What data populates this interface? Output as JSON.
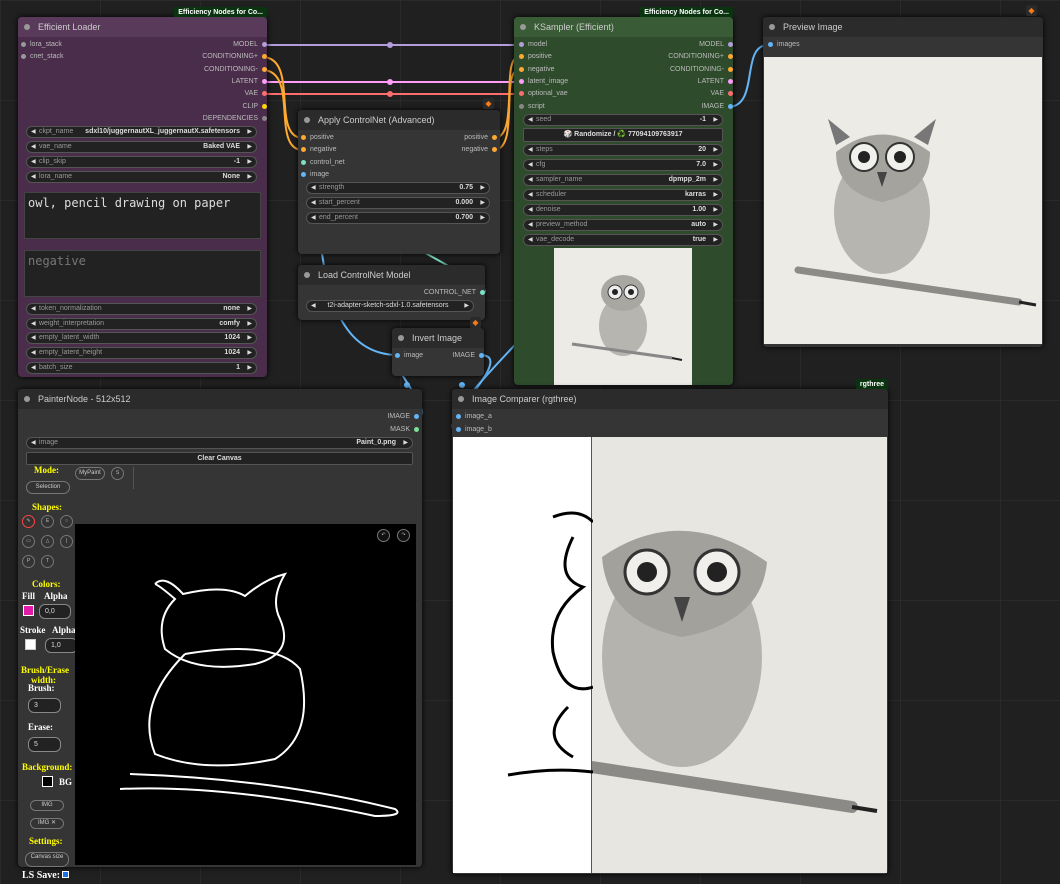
{
  "colors": {
    "loader_body": "#4a2d4b",
    "loader_header": "#5a3a5b",
    "ksampler_body": "#2e4c2c",
    "ksampler_header": "#395b35",
    "node_body": "#353535",
    "node_header": "#2b2b2b",
    "canvas_bg": "#ffffff",
    "painter_canvas": "#000000"
  },
  "efficient_loader": {
    "badge": "Efficiency Nodes for Co...",
    "title": "Efficient Loader",
    "inputs": [
      "lora_stack",
      "cnet_stack"
    ],
    "outputs": [
      "MODEL",
      "CONDITIONING+",
      "CONDITIONING-",
      "LATENT",
      "VAE",
      "CLIP",
      "DEPENDENCIES"
    ],
    "widgets": [
      {
        "name": "ckpt_name",
        "value": "sdxl10/juggernautXL_juggernautX.safetensors"
      },
      {
        "name": "vae_name",
        "value": "Baked VAE"
      },
      {
        "name": "clip_skip",
        "value": "-1"
      },
      {
        "name": "lora_name",
        "value": "None"
      }
    ],
    "positive_text": "owl, pencil drawing on paper",
    "negative_placeholder": "negative",
    "widgets2": [
      {
        "name": "token_normalization",
        "value": "none"
      },
      {
        "name": "weight_interpretation",
        "value": "comfy"
      },
      {
        "name": "empty_latent_width",
        "value": "1024"
      },
      {
        "name": "empty_latent_height",
        "value": "1024"
      },
      {
        "name": "batch_size",
        "value": "1"
      }
    ]
  },
  "apply_controlnet": {
    "title": "Apply ControlNet (Advanced)",
    "inputs": [
      "positive",
      "negative",
      "control_net",
      "image"
    ],
    "outputs": [
      "positive",
      "negative"
    ],
    "widgets": [
      {
        "name": "strength",
        "value": "0.75"
      },
      {
        "name": "start_percent",
        "value": "0.000"
      },
      {
        "name": "end_percent",
        "value": "0.700"
      }
    ]
  },
  "load_controlnet": {
    "title": "Load ControlNet Model",
    "output": "CONTROL_NET",
    "control_net_name": "t2i-adapter-sketch-sdxl-1.0.safetensors"
  },
  "invert_image": {
    "title": "Invert Image",
    "input": "image",
    "output": "IMAGE"
  },
  "ksampler": {
    "badge": "Efficiency Nodes for Co...",
    "title": "KSampler (Efficient)",
    "inputs": [
      "model",
      "positive",
      "negative",
      "latent_image",
      "optional_vae",
      "script"
    ],
    "outputs": [
      "MODEL",
      "CONDITIONING+",
      "CONDITIONING-",
      "LATENT",
      "VAE",
      "IMAGE"
    ],
    "seed": {
      "name": "seed",
      "value": "-1"
    },
    "randomize_label": "🎲 Randomize / ♻️ 770941097639​17",
    "widgets": [
      {
        "name": "steps",
        "value": "20"
      },
      {
        "name": "cfg",
        "value": "7.0"
      },
      {
        "name": "sampler_name",
        "value": "dpmpp_2m"
      },
      {
        "name": "scheduler",
        "value": "karras"
      },
      {
        "name": "denoise",
        "value": "1.00"
      },
      {
        "name": "preview_method",
        "value": "auto"
      },
      {
        "name": "vae_decode",
        "value": "true"
      }
    ]
  },
  "preview": {
    "title": "Preview Image",
    "input": "images"
  },
  "painter": {
    "title": "PainterNode - 512x512",
    "outputs": [
      "IMAGE",
      "MASK"
    ],
    "image_name": "image",
    "image_value": "Paint_0.png",
    "clear": "Clear Canvas",
    "mode_label": "Mode:",
    "mypaint": "MyPaint",
    "s_btn": "S",
    "selection": "Selection",
    "shapes_label": "Shapes:",
    "colors_label": "Colors:",
    "fill": "Fill",
    "alpha": "Alpha",
    "fill_alpha": "0,0",
    "stroke": "Stroke",
    "alpha2": "Alpha",
    "stroke_alpha": "1,0",
    "brush_erase": "Brush/Erase width:",
    "brush": "Brush:",
    "brush_val": "3",
    "erase": "Erase:",
    "erase_val": "5",
    "background_label": "Background:",
    "bg": "BG",
    "img": "IMG",
    "img_x": "IMG ✕",
    "settings_label": "Settings:",
    "canvas_size": "Canvas size",
    "ls_save": "LS Save:"
  },
  "comparer": {
    "badge": "rgthree",
    "title": "Image Comparer (rgthree)",
    "inputs": [
      "image_a",
      "image_b"
    ]
  }
}
